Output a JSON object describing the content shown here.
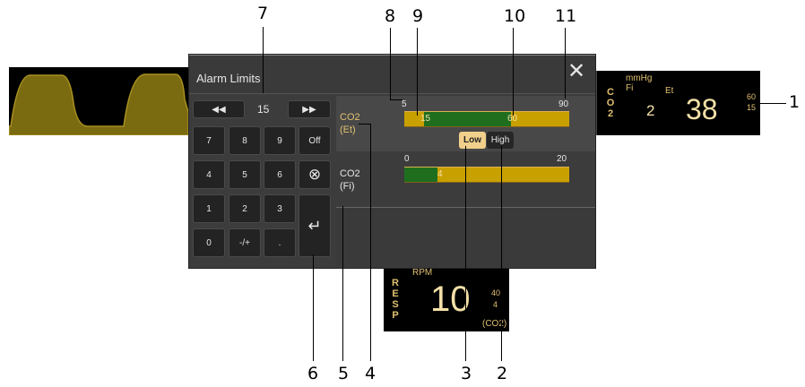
{
  "dialog": {
    "title": "Alarm Limits",
    "close_glyph": "✕",
    "current_value": "15",
    "prev_glyph": "◀◀",
    "next_glyph": "▶▶",
    "keypad": [
      "7",
      "8",
      "9",
      "Off",
      "4",
      "5",
      "6",
      "⊗",
      "1",
      "2",
      "3",
      "0",
      "-/+",
      "."
    ],
    "enter_glyph": "↵"
  },
  "co2_et_row": {
    "label_line1": "CO2",
    "label_line2": "(Et)",
    "scale_min": "5",
    "scale_max": "90",
    "low_limit": "15",
    "high_limit": "60",
    "low_button": "Low",
    "high_button": "High",
    "low_fraction": 0.118,
    "high_fraction": 0.647
  },
  "co2_fi_row": {
    "label_line1": "CO2",
    "label_line2": "(Fi)",
    "scale_min": "0",
    "scale_max": "20",
    "high_limit": "4",
    "high_fraction": 0.2
  },
  "co2_tile": {
    "side_label": [
      "C",
      "O",
      "2"
    ],
    "unit": "mmHg",
    "fi_label": "Fi",
    "et_label": "Et",
    "fi_value": "2",
    "et_value": "38",
    "upper_limit": "60",
    "lower_limit": "15"
  },
  "resp_tile": {
    "side_label": [
      "R",
      "E",
      "S",
      "P"
    ],
    "unit": "RPM",
    "value": "10",
    "upper_limit": "40",
    "lower_limit": "4",
    "source": "(CO2)"
  },
  "callouts": [
    "1",
    "2",
    "3",
    "4",
    "5",
    "6",
    "7",
    "8",
    "9",
    "10",
    "11"
  ],
  "colors": {
    "waveform": "#7a6a10",
    "accent_gold": "#e0c070",
    "bar_green": "#1e6e1e",
    "bar_gold": "#c8a000"
  }
}
